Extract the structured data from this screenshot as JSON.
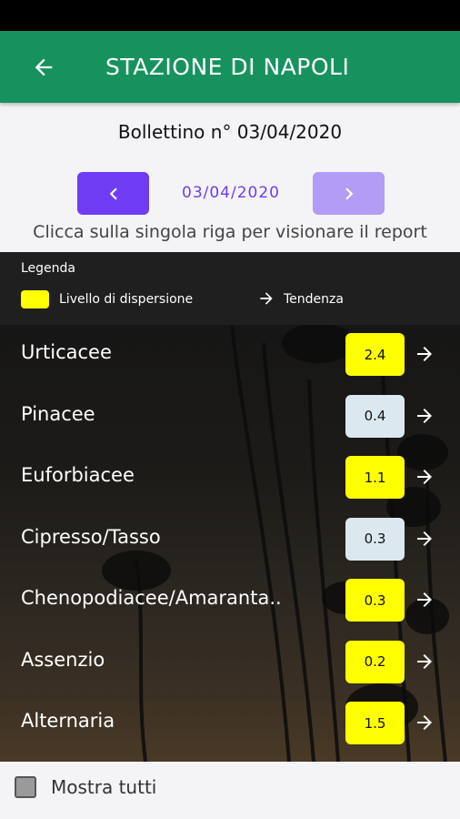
{
  "app_bar": {
    "title": "STAZIONE DI NAPOLI"
  },
  "bulletin": {
    "label": "Bollettino n° 03/04/2020"
  },
  "date_nav": {
    "date": "03/04/2020"
  },
  "hint": "Clicca sulla singola riga per visionare il report",
  "legend": {
    "title": "Legenda",
    "dispersion_label": "Livello di dispersione",
    "trend_label": "Tendenza",
    "swatch_color": "#ffff00"
  },
  "pollens": [
    {
      "name": "Urticacee",
      "value": "2.4",
      "color": "#ffff00"
    },
    {
      "name": "Pinacee",
      "value": "0.4",
      "color": "#dbe8ef"
    },
    {
      "name": "Euforbiacee",
      "value": "1.1",
      "color": "#ffff00"
    },
    {
      "name": "Cipresso/Tasso",
      "value": "0.3",
      "color": "#dbe8ef"
    },
    {
      "name": "Chenopodiacee/Amaranta..",
      "value": "0.3",
      "color": "#ffff00"
    },
    {
      "name": "Assenzio",
      "value": "0.2",
      "color": "#ffff00"
    },
    {
      "name": "Alternaria",
      "value": "1.5",
      "color": "#ffff00"
    }
  ],
  "footer": {
    "show_all_label": "Mostra tutti"
  },
  "colors": {
    "primary": "#17925f",
    "accent": "#6f3cf3",
    "accent_light": "#b29cf6"
  }
}
